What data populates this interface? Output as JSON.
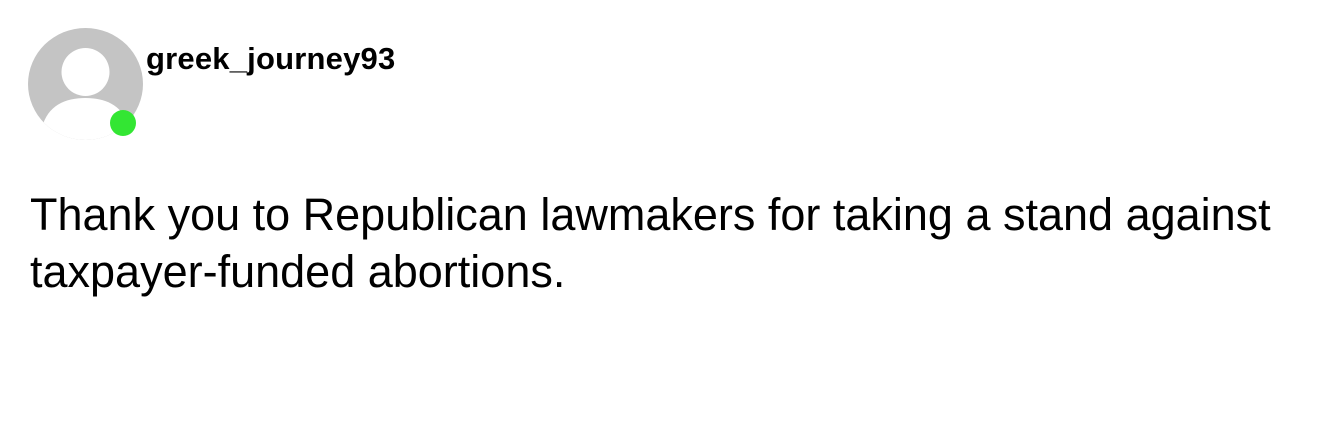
{
  "post": {
    "username": "greek_journey93",
    "online_status_color": "#33e633",
    "avatar_icon": "default-user-avatar-icon",
    "message": "Thank you to Republican lawmakers for taking a stand against taxpayer-funded abortions."
  }
}
